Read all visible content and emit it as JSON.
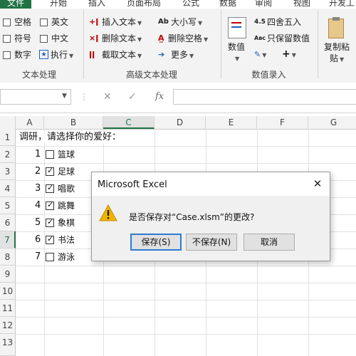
{
  "tabs": [
    "文件",
    "开始",
    "插入",
    "页面布局",
    "公式",
    "数据",
    "审阅",
    "视图",
    "开发工"
  ],
  "ribbon": {
    "text_group": {
      "items": [
        "空格",
        "英文",
        "符号",
        "中文",
        "数字",
        "执行"
      ],
      "label": "文本处理"
    },
    "advanced_group": {
      "insert_text": "插入文本",
      "delete_text": "删除文本",
      "extract_text": "截取文本",
      "case": "大小写",
      "delete_space": "删除空格",
      "more": "更多",
      "label": "高级文本处理"
    },
    "number_group": {
      "value": "数值",
      "round": "四舍五入",
      "keep_value": "只保留数值",
      "label": "数值录入"
    },
    "clipboard": {
      "copy_paste_line1": "复制粘",
      "copy_paste_line2": "贴"
    }
  },
  "formula_bar": {
    "fx": "fx",
    "name_box": "",
    "content": ""
  },
  "sheet": {
    "columns": [
      "A",
      "B",
      "C",
      "D",
      "E",
      "F",
      "G"
    ],
    "rows": [
      "1",
      "2",
      "3",
      "4",
      "5",
      "6",
      "7",
      "8",
      "9",
      "10",
      "11",
      "12",
      "13"
    ],
    "title": "调研，请选择你的爱好：",
    "hobbies": [
      {
        "num": "1",
        "label": "篮球",
        "checked": false
      },
      {
        "num": "2",
        "label": "足球",
        "checked": true
      },
      {
        "num": "3",
        "label": "唱歌",
        "checked": true
      },
      {
        "num": "4",
        "label": "跳舞",
        "checked": true
      },
      {
        "num": "5",
        "label": "象棋",
        "checked": true
      },
      {
        "num": "6",
        "label": "书法",
        "checked": true
      },
      {
        "num": "7",
        "label": "游泳",
        "checked": false
      }
    ]
  },
  "dialog": {
    "title": "Microsoft Excel",
    "message": "是否保存对“Case.xlsm”的更改?",
    "buttons": {
      "save": "保存(S)",
      "dont_save": "不保存(N)",
      "cancel": "取消"
    }
  },
  "colors": {
    "accent": "#217346",
    "dialog_default_border": "#2b7cd3",
    "warning": "#f0b400"
  }
}
